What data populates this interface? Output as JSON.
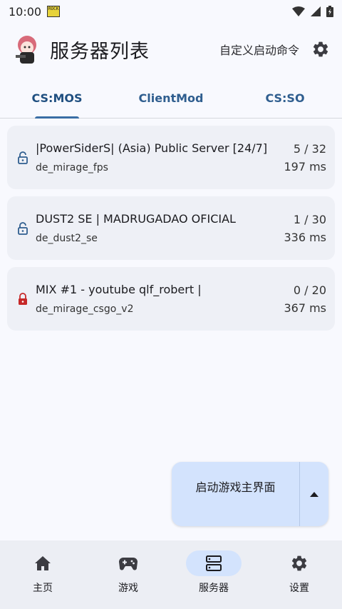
{
  "status_bar": {
    "time": "10:00",
    "app_icon_text": "ROCK"
  },
  "header": {
    "title": "服务器列表",
    "custom_command": "自定义启动命令"
  },
  "tabs": [
    {
      "label": "CS:MOS",
      "active": true
    },
    {
      "label": "ClientMod",
      "active": false
    },
    {
      "label": "CS:SO",
      "active": false
    }
  ],
  "servers": [
    {
      "name": "|PowerSiderS| (Asia) Public Server [24/7]",
      "map": "de_mirage_fps",
      "players": "5 / 32",
      "ping": "197 ms",
      "lock": "unlocked"
    },
    {
      "name": "DUST2 SE | MADRUGADAO OFICIAL",
      "map": "de_dust2_se",
      "players": "1 / 30",
      "ping": "336 ms",
      "lock": "unlocked"
    },
    {
      "name": "MIX #1 - youtube qlf_robert |",
      "map": "de_mirage_csgo_v2",
      "players": "0 / 20",
      "ping": "367 ms",
      "lock": "locked"
    }
  ],
  "fab": {
    "label": "启动游戏主界面"
  },
  "bottom_nav": [
    {
      "label": "主页",
      "icon": "home-icon",
      "active": false
    },
    {
      "label": "游戏",
      "icon": "gamepad-icon",
      "active": false
    },
    {
      "label": "服务器",
      "icon": "server-icon",
      "active": true
    },
    {
      "label": "设置",
      "icon": "gear-icon",
      "active": false
    }
  ],
  "colors": {
    "accent": "#3a6ea5",
    "tab_text": "#2f5e8f",
    "lock_locked": "#c62828",
    "lock_unlocked": "#2f5e8f",
    "fab_bg": "#d3e3fd"
  }
}
